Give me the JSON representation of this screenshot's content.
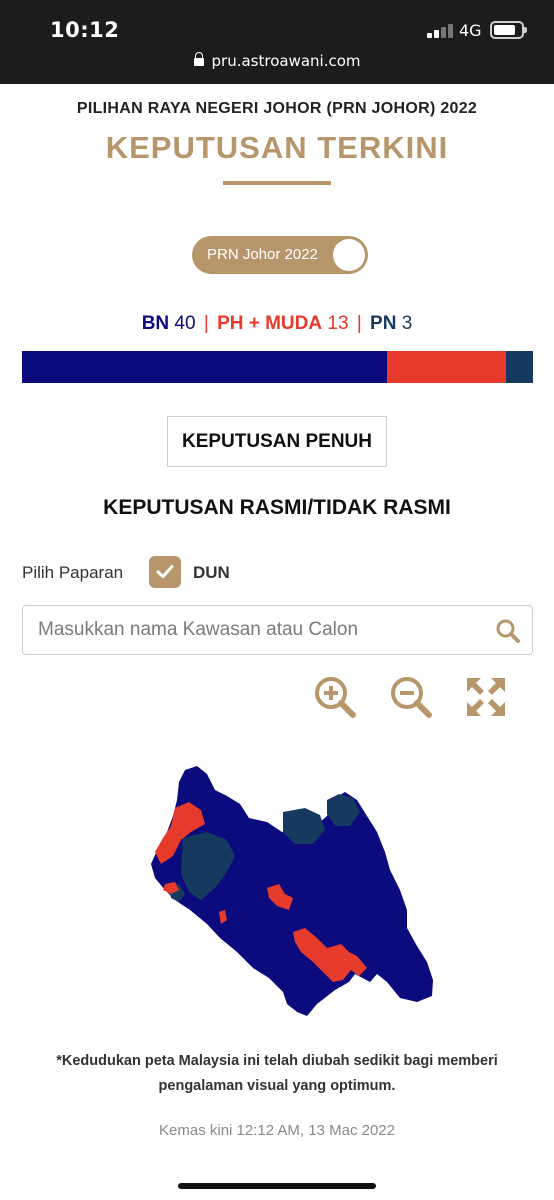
{
  "status_bar": {
    "time": "10:12",
    "network": "4G"
  },
  "browser": {
    "url": "pru.astroawani.com"
  },
  "header": {
    "subtitle": "PILIHAN RAYA NEGERI JOHOR (PRN JOHOR) 2022",
    "title": "KEPUTUSAN TERKINI"
  },
  "toggle": {
    "label": "PRN Johor 2022"
  },
  "tally": {
    "bn_label": "BN",
    "bn_seats": "40",
    "ph_label": "PH + MUDA",
    "ph_seats": "13",
    "pn_label": "PN",
    "pn_seats": "3",
    "separator": "|"
  },
  "seat_bar": {
    "segments": [
      {
        "party": "BN",
        "seats": 40,
        "color": "#0b0b7e"
      },
      {
        "party": "PH + MUDA",
        "seats": 13,
        "color": "#e63a2a"
      },
      {
        "party": "PN",
        "seats": 3,
        "color": "#163a5f"
      }
    ]
  },
  "full_results_button": {
    "label": "KEPUTUSAN PENUH"
  },
  "section": {
    "heading": "KEPUTUSAN RASMI/TIDAK RASMI"
  },
  "view": {
    "label": "Pilih Paparan",
    "option": "DUN",
    "checked": true
  },
  "search": {
    "placeholder": "Masukkan nama Kawasan atau Calon",
    "value": ""
  },
  "map_controls": {
    "icons": [
      "zoom-in-icon",
      "zoom-out-icon",
      "fullscreen-icon"
    ],
    "color": "#b8966b"
  },
  "map": {
    "colors": {
      "bn": "#0b0b7e",
      "ph": "#e63a2a",
      "pn": "#163a5f"
    }
  },
  "footer": {
    "note_line1": "*Kedudukan peta Malaysia ini telah diubah sedikit bagi memberi",
    "note_line2": "pengalaman visual yang optimum.",
    "updated": "Kemas kini 12:12 AM, 13 Mac 2022"
  }
}
